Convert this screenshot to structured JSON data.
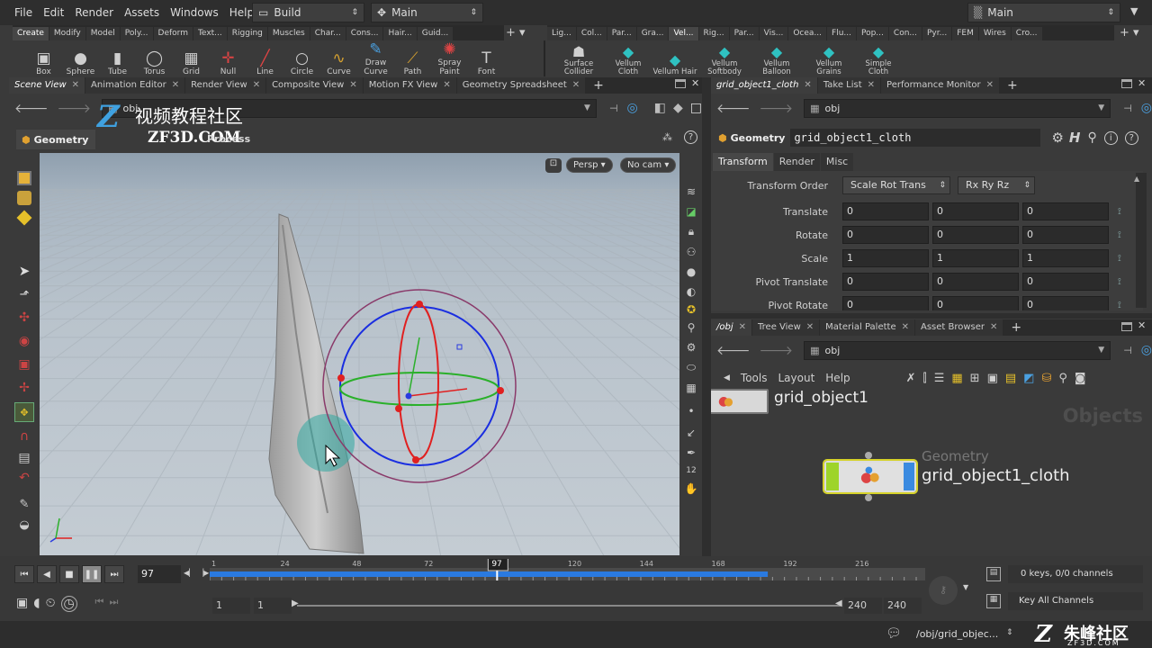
{
  "menubar": {
    "items": [
      "File",
      "Edit",
      "Render",
      "Assets",
      "Windows",
      "Help"
    ],
    "desktop": "Build",
    "context": "Main",
    "right_desktop": "Main"
  },
  "shelf": {
    "tabs_left": [
      "Create",
      "Modify",
      "Model",
      "Poly...",
      "Deform",
      "Text...",
      "Rigging",
      "Muscles",
      "Char...",
      "Cons...",
      "Hair...",
      "Guid..."
    ],
    "tabs_right": [
      "Lig...",
      "Col...",
      "Par...",
      "Gra...",
      "Vel...",
      "Rig...",
      "Par...",
      "Vis...",
      "Ocea...",
      "Flu...",
      "Pop...",
      "Con...",
      "Pyr...",
      "FEM",
      "Wires",
      "Cro..."
    ],
    "tools_left": [
      "Box",
      "Sphere",
      "Tube",
      "Torus",
      "Grid",
      "Null",
      "Line",
      "Circle",
      "Curve",
      "Draw Curve",
      "Path",
      "Spray Paint",
      "Font"
    ],
    "tools_right": [
      "Surface Collider",
      "Vellum Cloth",
      "Vellum Hair",
      "Vellum Softbody",
      "Vellum Balloon",
      "Vellum Grains",
      "Simple Cloth"
    ],
    "accent_orange": "#d46b2a",
    "accent_cyan": "#2fc2c2"
  },
  "left_pane": {
    "tabs": [
      "Scene View",
      "Animation Editor",
      "Render View",
      "Composite View",
      "Motion FX View",
      "Geometry Spreadsheet"
    ],
    "path": "obj",
    "watermark_top": "视频教程社区",
    "watermark_sub": "ZF3D.COM",
    "subheader": "Geometry",
    "subheader_extra": "Process",
    "persp": "Persp",
    "cam": "No cam"
  },
  "param_pane": {
    "tabs": [
      "grid_object1_cloth",
      "Take List",
      "Performance Monitor"
    ],
    "path": "obj",
    "node_type": "Geometry",
    "node_name": "grid_object1_cloth",
    "subtabs": [
      "Transform",
      "Render",
      "Misc"
    ],
    "transform_order_label": "Transform Order",
    "transform_order": "Scale Rot Trans",
    "rot_order": "Rx Ry Rz",
    "rows": [
      {
        "label": "Translate",
        "values": [
          "0",
          "0",
          "0"
        ]
      },
      {
        "label": "Rotate",
        "values": [
          "0",
          "0",
          "0"
        ]
      },
      {
        "label": "Scale",
        "values": [
          "1",
          "1",
          "1"
        ]
      },
      {
        "label": "Pivot Translate",
        "values": [
          "0",
          "0",
          "0"
        ]
      },
      {
        "label": "Pivot Rotate",
        "values": [
          "0",
          "0",
          "0"
        ]
      }
    ]
  },
  "network_pane": {
    "tabs": [
      "/obj",
      "Tree View",
      "Material Palette",
      "Asset Browser"
    ],
    "path": "obj",
    "menu": [
      "Tools",
      "Layout",
      "Help"
    ],
    "watermark": "Objects",
    "node1": "grid_object1",
    "node2_type": "Geometry",
    "node2": "grid_object1_cloth"
  },
  "timeline": {
    "current_frame": "97",
    "ticks": [
      "1",
      "24",
      "48",
      "72",
      "97",
      "120",
      "144",
      "168",
      "192",
      "216"
    ],
    "start": "1",
    "start2": "1",
    "end": "240",
    "end2": "240",
    "keys_info": "0 keys, 0/0 channels",
    "key_all": "Key All Channels",
    "cache_frac": 0.78,
    "playhead_frac": 0.38
  },
  "statusbar": {
    "path": "/obj/grid_objec...",
    "logo_cn": "朱峰社区",
    "logo_en": "ZF3D.COM"
  }
}
